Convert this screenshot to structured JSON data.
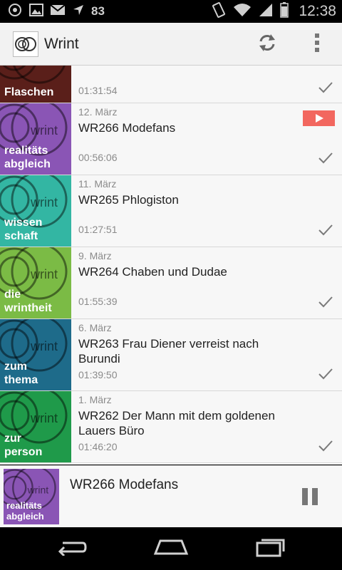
{
  "status_bar": {
    "battery_level_text": "83",
    "time": "12:38",
    "icons": [
      "usb-icon",
      "image-icon",
      "gmail-icon",
      "navigation-icon",
      "vibrate-icon",
      "wifi-icon",
      "signal-icon",
      "battery-icon"
    ]
  },
  "action_bar": {
    "title": "Wrint",
    "icons": [
      "app-logo-icon",
      "refresh-icon",
      "overflow-menu-icon"
    ]
  },
  "episodes": [
    {
      "date": "",
      "title": "",
      "duration": "01:31:54",
      "thumb_label": [
        "Flaschen"
      ],
      "thumb_color": "#5a1f1a",
      "listened": true,
      "playing": false
    },
    {
      "date": "12. März",
      "title": "WR266 Modefans",
      "duration": "00:56:06",
      "thumb_label": [
        "realitäts",
        "abgleich"
      ],
      "thumb_color": "#8a55b5",
      "listened": true,
      "playing": true
    },
    {
      "date": "11. März",
      "title": "WR265 Phlogiston",
      "duration": "01:27:51",
      "thumb_label": [
        "wissen",
        "schaft"
      ],
      "thumb_color": "#33b6a3",
      "listened": true,
      "playing": false
    },
    {
      "date": "9. März",
      "title": "WR264 Chaben und Dudae",
      "duration": "01:55:39",
      "thumb_label": [
        "die",
        "wrintheit"
      ],
      "thumb_color": "#7bbb45",
      "listened": true,
      "playing": false
    },
    {
      "date": "6. März",
      "title": "WR263 Frau Diener verreist nach Burundi",
      "duration": "01:39:50",
      "thumb_label": [
        "zum",
        "thema"
      ],
      "thumb_color": "#1e6b8a",
      "listened": true,
      "playing": false
    },
    {
      "date": "1. März",
      "title": "WR262 Der Mann mit dem goldenen Lauers Büro",
      "duration": "01:46:20",
      "thumb_label": [
        "zur",
        "person"
      ],
      "thumb_color": "#1f9a4a",
      "listened": true,
      "playing": false
    }
  ],
  "player": {
    "title": "WR266 Modefans",
    "thumb_label": [
      "realitäts",
      "abgleich"
    ],
    "thumb_color": "#8a55b5",
    "logo_text": "wrint"
  },
  "thumb_logo_text": "wrint",
  "nav_bar": {
    "icons": [
      "back-icon",
      "home-icon",
      "recents-icon"
    ]
  },
  "colors": {
    "play_badge": "#f2675f",
    "checkmark": "#7a7a7a",
    "list_bg": "#f7f7f7"
  }
}
